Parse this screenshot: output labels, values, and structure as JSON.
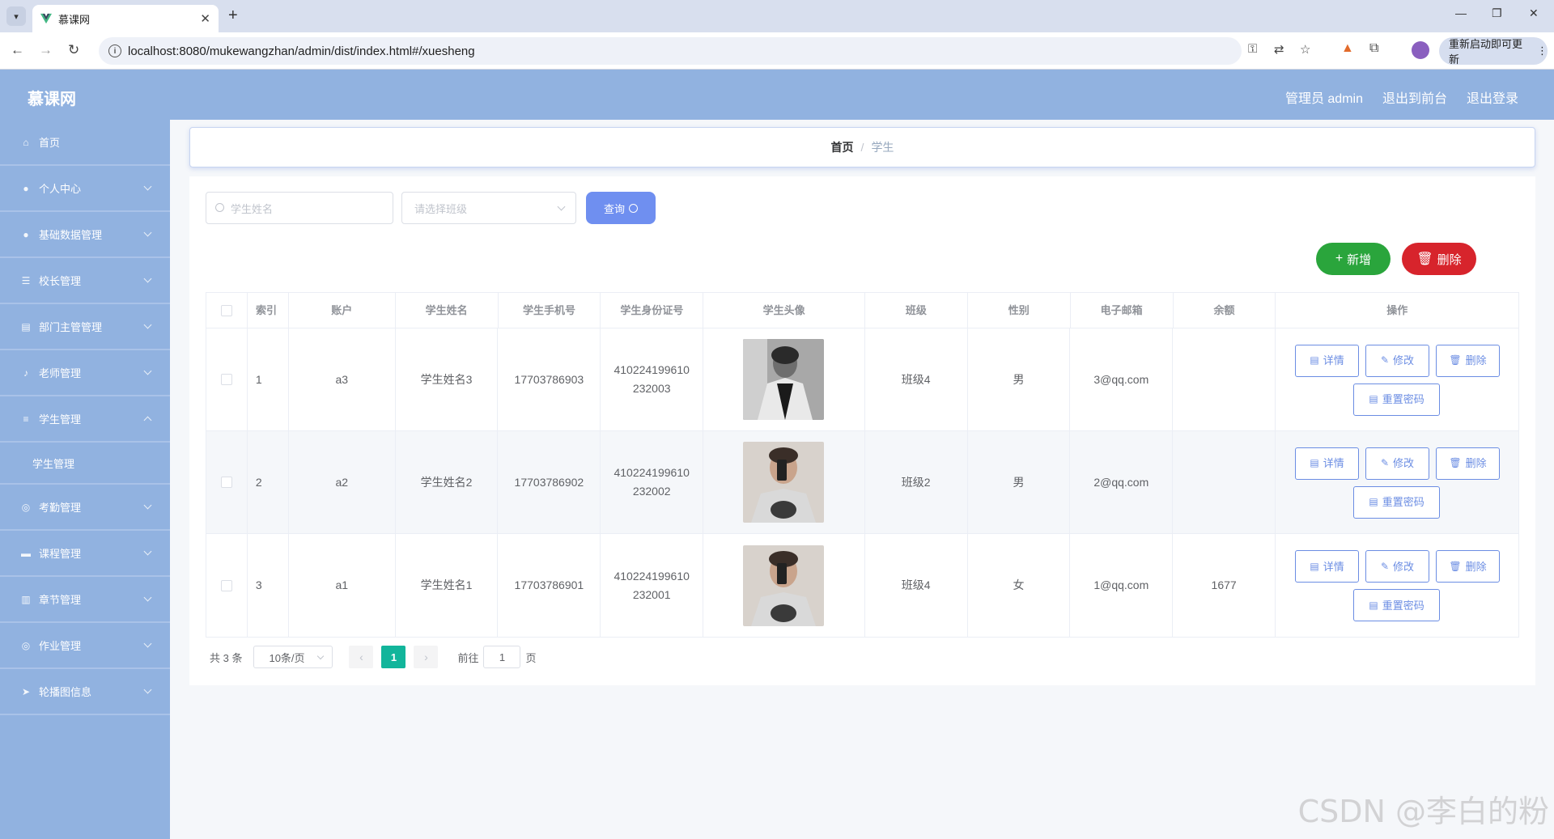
{
  "browser": {
    "tab_title": "慕课网",
    "url": "localhost:8080/mukewangzhan/admin/dist/index.html#/xuesheng",
    "update_button": "重新启动即可更新"
  },
  "header": {
    "logo": "慕课网",
    "admin_label": "管理员 admin",
    "to_front": "退出到前台",
    "logout": "退出登录"
  },
  "sidebar": {
    "items": [
      {
        "label": "首页",
        "icon": "home-icon"
      },
      {
        "label": "个人中心",
        "icon": "user-icon"
      },
      {
        "label": "基础数据管理",
        "icon": "user-icon"
      },
      {
        "label": "校长管理",
        "icon": "sliders-icon"
      },
      {
        "label": "部门主管管理",
        "icon": "clipboard-icon"
      },
      {
        "label": "老师管理",
        "icon": "mic-icon"
      },
      {
        "label": "学生管理",
        "icon": "menu-icon"
      },
      {
        "label": "考勤管理",
        "icon": "globe-icon"
      },
      {
        "label": "课程管理",
        "icon": "chat-icon"
      },
      {
        "label": "章节管理",
        "icon": "chart-icon"
      },
      {
        "label": "作业管理",
        "icon": "globe-icon"
      },
      {
        "label": "轮播图信息",
        "icon": "send-icon"
      }
    ],
    "submenu_student": "学生管理"
  },
  "breadcrumb": {
    "home": "首页",
    "current": "学生"
  },
  "search": {
    "name_placeholder": "学生姓名",
    "class_placeholder": "请选择班级",
    "query_button": "查询"
  },
  "actions": {
    "add": "新增",
    "delete": "删除"
  },
  "table": {
    "headers": [
      "索引",
      "账户",
      "学生姓名",
      "学生手机号",
      "学生身份证号",
      "学生头像",
      "班级",
      "性别",
      "电子邮箱",
      "余额",
      "操作"
    ],
    "rows": [
      {
        "index": "1",
        "account": "a3",
        "name": "学生姓名3",
        "phone": "17703786903",
        "id_a": "410224199610",
        "id_b": "232003",
        "class": "班级4",
        "gender": "男",
        "email": "3@qq.com",
        "balance": ""
      },
      {
        "index": "2",
        "account": "a2",
        "name": "学生姓名2",
        "phone": "17703786902",
        "id_a": "410224199610",
        "id_b": "232002",
        "class": "班级2",
        "gender": "男",
        "email": "2@qq.com",
        "balance": ""
      },
      {
        "index": "3",
        "account": "a1",
        "name": "学生姓名1",
        "phone": "17703786901",
        "id_a": "410224199610",
        "id_b": "232001",
        "class": "班级4",
        "gender": "女",
        "email": "1@qq.com",
        "balance": "1677"
      }
    ],
    "op_labels": {
      "detail": "详情",
      "edit": "修改",
      "delete": "删除",
      "reset": "重置密码"
    }
  },
  "pagination": {
    "total": "共 3 条",
    "page_size": "10条/页",
    "current": "1",
    "goto_prefix": "前往",
    "goto_value": "1",
    "goto_suffix": "页"
  },
  "watermark": "CSDN @李白的粉",
  "colors": {
    "header_bg": "#91b2e0",
    "query_btn": "#6f8ff0",
    "add_btn": "#2aa53c",
    "delete_btn": "#d7242c",
    "page_active": "#12b59b",
    "op_btn": "#6b8de3"
  }
}
